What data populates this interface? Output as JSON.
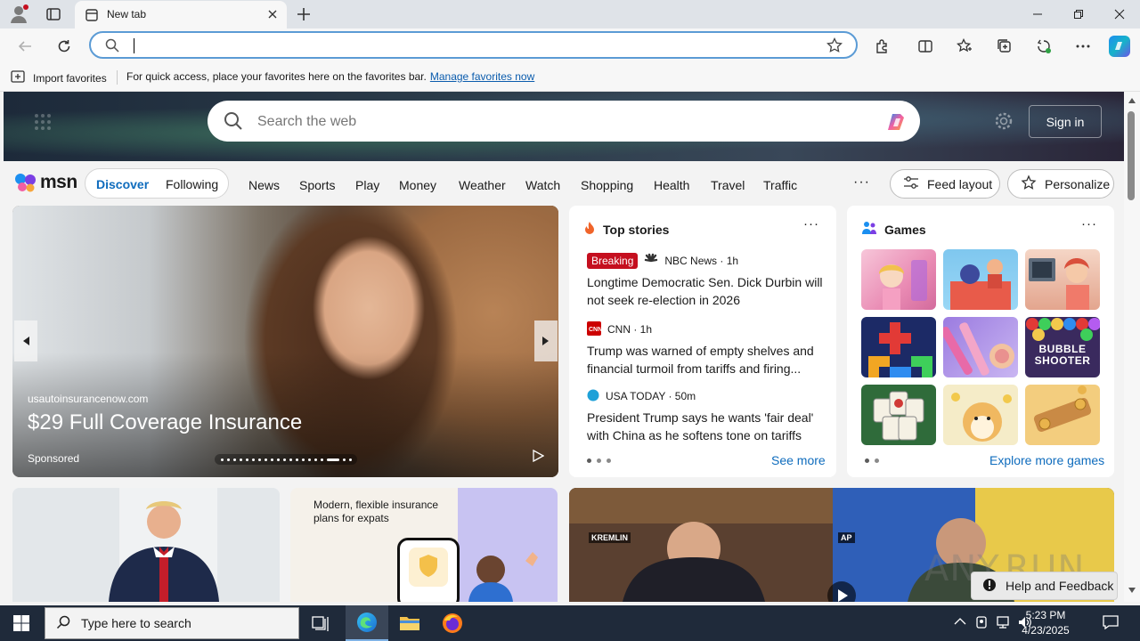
{
  "browser": {
    "tab_title": "New tab",
    "address_value": "",
    "favorites_bar": {
      "import_label": "Import favorites",
      "message": "For quick access, place your favorites here on the favorites bar.",
      "link": "Manage favorites now"
    }
  },
  "msn": {
    "search_placeholder": "Search the web",
    "signin_label": "Sign in",
    "logo_text": "msn",
    "pill": {
      "discover": "Discover",
      "following": "Following"
    },
    "nav_items": [
      "News",
      "Sports",
      "Play",
      "Money",
      "Weather",
      "Watch",
      "Shopping",
      "Health",
      "Travel",
      "Traffic"
    ],
    "more_label": "···",
    "feed_layout_label": "Feed layout",
    "personalize_label": "Personalize",
    "carousel": {
      "source": "usautoinsurancenow.com",
      "headline": "$29 Full Coverage Insurance",
      "sponsored": "Sponsored",
      "slide_count": 20,
      "active_slide": 17
    },
    "top_stories": {
      "title": "Top stories",
      "more": "···",
      "stories": [
        {
          "badge": "Breaking",
          "source": "NBC News · 1h",
          "headline": "Longtime Democratic Sen. Dick Durbin will not seek re-election in 2026"
        },
        {
          "badge": "",
          "source": "CNN · 1h",
          "headline": "Trump was warned of empty shelves and financial turmoil from tariffs and firing..."
        },
        {
          "badge": "",
          "source": "USA TODAY · 50m",
          "headline": "President Trump says he wants 'fair deal' with China as he softens tone on tariffs"
        }
      ],
      "see_more": "See more"
    },
    "games": {
      "title": "Games",
      "more": "···",
      "explore": "Explore more games",
      "tile_text": {
        "bubble_shooter": "BUBBLE SHOOTER"
      }
    },
    "bottom_cards": {
      "ad_heading": "Modern, flexible insurance plans for expats",
      "tag_kremlin": "KREMLIN",
      "tag_ap": "AP"
    },
    "watermark": "ANY.RUN",
    "help_label": "Help and Feedback"
  },
  "taskbar": {
    "search_placeholder": "Type here to search",
    "time": "5:23 PM",
    "date": "4/23/2025"
  },
  "colors": {
    "accent": "#0f6cbd",
    "breaking": "#c50f1f",
    "taskbar": "#1f2a3a"
  }
}
